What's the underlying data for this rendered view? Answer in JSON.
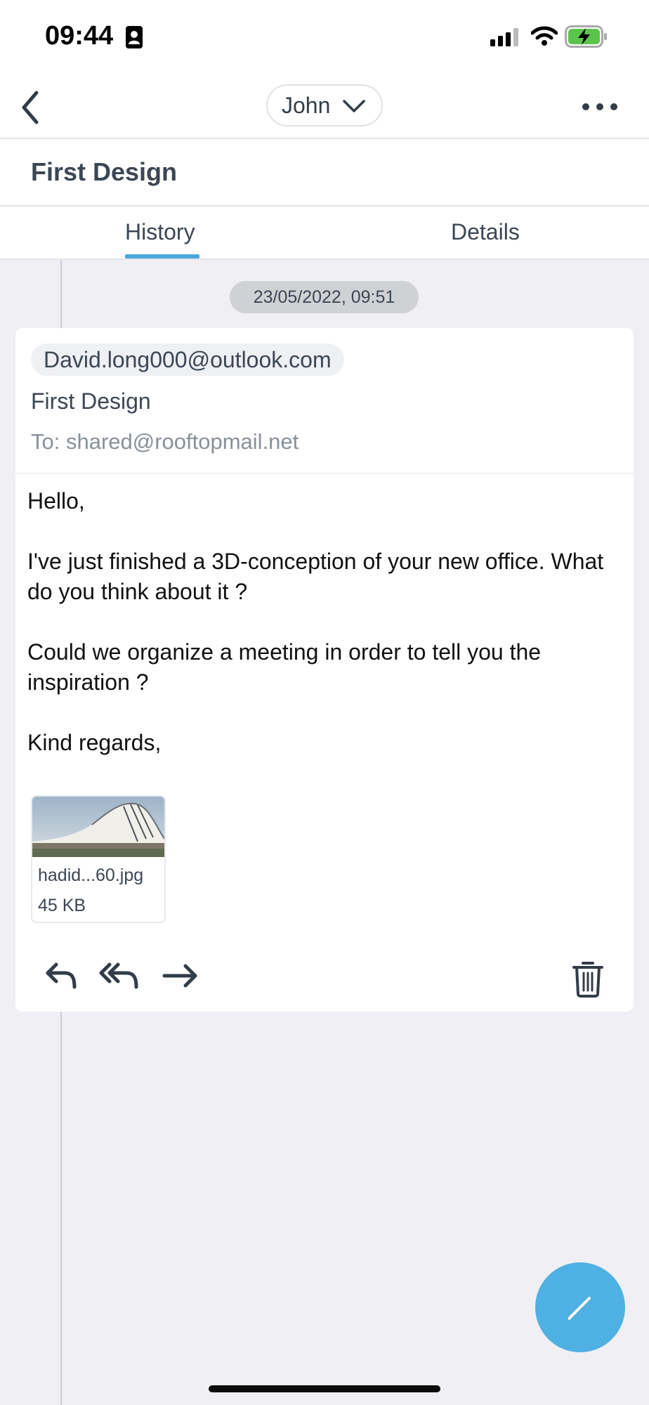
{
  "status_bar": {
    "time": "09:44"
  },
  "nav": {
    "account_name": "John"
  },
  "page": {
    "title": "First Design"
  },
  "tabs": [
    {
      "label": "History",
      "active": true
    },
    {
      "label": "Details",
      "active": false
    }
  ],
  "timeline": {
    "date": "23/05/2022, 09:51"
  },
  "mail": {
    "sender": "David.long000@outlook.com",
    "subject": "First Design",
    "to": "To: shared@rooftopmail.net",
    "body": [
      "Hello,",
      "I've just finished a 3D-conception of your new office. What do you think about it ?",
      "Could we organize a meeting in order to tell you the inspiration ?",
      "Kind regards,"
    ],
    "attachment": {
      "name": "hadid...60.jpg",
      "size": "45 KB"
    }
  },
  "icons": [
    "back-icon",
    "chevron-down-icon",
    "more-icon",
    "reply-icon",
    "reply-all-icon",
    "forward-icon",
    "trash-icon",
    "pencil-icon"
  ],
  "colors": {
    "accent": "#4aa8dd",
    "compose_button": "#4fb0e3",
    "background": "#efeff4"
  }
}
